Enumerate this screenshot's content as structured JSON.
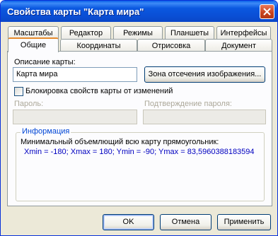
{
  "window": {
    "title": "Свойства карты \"Карта мира\""
  },
  "tabs_row1": [
    {
      "label": "Масштабы"
    },
    {
      "label": "Редактор"
    },
    {
      "label": "Режимы"
    },
    {
      "label": "Планшеты"
    },
    {
      "label": "Интерфейсы"
    }
  ],
  "tabs_row2": [
    {
      "label": "Общие",
      "active": true
    },
    {
      "label": "Координаты"
    },
    {
      "label": "Отрисовка"
    },
    {
      "label": "Документ"
    }
  ],
  "general": {
    "description_label": "Описание карты:",
    "description_value": "Карта мира",
    "clip_zone_button": "Зона отсечения изображения...",
    "lock_checkbox_label": "Блокировка свойств карты от изменений",
    "lock_checked": false,
    "password_label": "Пароль:",
    "password_value": "",
    "confirm_label": "Подтверждение пароля:",
    "confirm_value": ""
  },
  "info": {
    "title": "Информация",
    "line1": "Минимальный объемлющий всю карту прямоугольник:",
    "line2": "Xmin = -180; Xmax = 180; Ymin = -90; Ymax = 83,5960388183594"
  },
  "buttons": {
    "ok": "OK",
    "cancel": "Отмена",
    "apply": "Применить"
  },
  "colors": {
    "titlebar": "#0a58e0",
    "dialog_bg": "#ece9d8",
    "info_text": "#0000c0",
    "group_title": "#0046d5"
  }
}
